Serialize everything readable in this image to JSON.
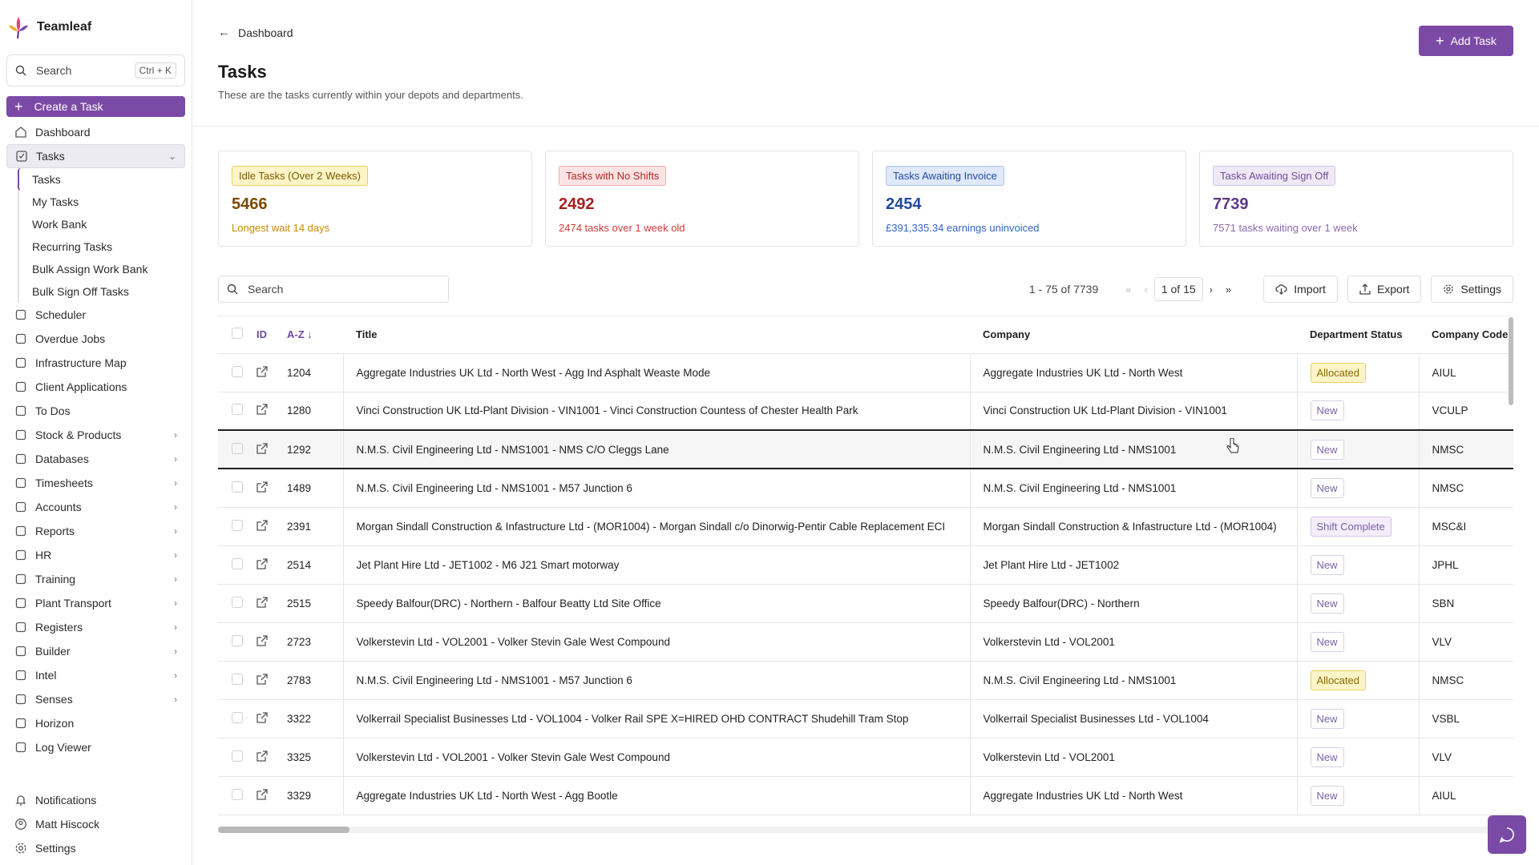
{
  "app": {
    "name": "Teamleaf"
  },
  "sidebar": {
    "search_label": "Search",
    "search_shortcut": "Ctrl + K",
    "create_label": "Create a Task",
    "items": [
      {
        "label": "Dashboard",
        "icon": "home-icon"
      },
      {
        "label": "Tasks",
        "icon": "checkbox-icon"
      },
      {
        "label": "Scheduler",
        "icon": "calendar-icon"
      },
      {
        "label": "Overdue Jobs",
        "icon": "warning-icon"
      },
      {
        "label": "Infrastructure Map",
        "icon": "map-icon"
      },
      {
        "label": "Client Applications",
        "icon": "chat-icon"
      },
      {
        "label": "To Dos",
        "icon": "list-icon"
      },
      {
        "label": "Stock & Products",
        "icon": "cubes-icon"
      },
      {
        "label": "Databases",
        "icon": "database-icon"
      },
      {
        "label": "Timesheets",
        "icon": "clock-icon"
      },
      {
        "label": "Accounts",
        "icon": "pound-icon"
      },
      {
        "label": "Reports",
        "icon": "bar-chart-icon"
      },
      {
        "label": "HR",
        "icon": "users-icon"
      },
      {
        "label": "Training",
        "icon": "graduation-cap-icon"
      },
      {
        "label": "Plant Transport",
        "icon": "truck-icon"
      },
      {
        "label": "Registers",
        "icon": "book-icon"
      },
      {
        "label": "Builder",
        "icon": "layers-icon"
      },
      {
        "label": "Intel",
        "icon": "gear-icon"
      },
      {
        "label": "Senses",
        "icon": "sensor-icon"
      },
      {
        "label": "Horizon",
        "icon": "horizon-icon"
      },
      {
        "label": "Log Viewer",
        "icon": "log-icon"
      }
    ],
    "task_sub": [
      "Tasks",
      "My Tasks",
      "Work Bank",
      "Recurring Tasks",
      "Bulk Assign Work Bank",
      "Bulk Sign Off Tasks"
    ],
    "bottom": {
      "notifications": "Notifications",
      "user": "Matt Hiscock",
      "settings": "Settings"
    }
  },
  "header": {
    "breadcrumb": "Dashboard",
    "title": "Tasks",
    "subtitle": "These are the tasks currently within your depots and departments.",
    "add_button": "Add Task"
  },
  "cards": [
    {
      "badge": "Idle Tasks (Over 2 Weeks)",
      "value": "5466",
      "sub": "Longest wait 14 days"
    },
    {
      "badge": "Tasks with No Shifts",
      "value": "2492",
      "sub": "2474 tasks over 1 week old"
    },
    {
      "badge": "Tasks Awaiting Invoice",
      "value": "2454",
      "sub": "£391,335.34 earnings uninvoiced"
    },
    {
      "badge": "Tasks Awaiting Sign Off",
      "value": "7739",
      "sub": "7571 tasks waiting over 1 week"
    }
  ],
  "toolbar": {
    "search_placeholder": "Search",
    "range": "1 - 75 of 7739",
    "page": "1 of 15",
    "import": "Import",
    "export": "Export",
    "settings": "Settings"
  },
  "table": {
    "headers": {
      "id": "ID",
      "sort": "A-Z",
      "title": "Title",
      "company": "Company",
      "status": "Department Status",
      "code": "Company Code"
    },
    "rows": [
      {
        "id": "1204",
        "title": "Aggregate Industries UK Ltd - North West - Agg Ind Asphalt Weaste Mode",
        "company": "Aggregate Industries UK Ltd - North West",
        "status": "Allocated",
        "code": "AIUL"
      },
      {
        "id": "1280",
        "title": "Vinci Construction UK Ltd-Plant Division - VIN1001 - Vinci Construction Countess of Chester Health Park",
        "company": "Vinci Construction UK Ltd-Plant Division - VIN1001",
        "status": "New",
        "code": "VCULP"
      },
      {
        "id": "1292",
        "title": "N.M.S. Civil Engineering Ltd - NMS1001 - NMS C/O Cleggs Lane",
        "company": "N.M.S. Civil Engineering Ltd - NMS1001",
        "status": "New",
        "code": "NMSC"
      },
      {
        "id": "1489",
        "title": "N.M.S. Civil Engineering Ltd - NMS1001 - M57 Junction 6",
        "company": "N.M.S. Civil Engineering Ltd - NMS1001",
        "status": "New",
        "code": "NMSC"
      },
      {
        "id": "2391",
        "title": "Morgan Sindall Construction & Infastructure Ltd - (MOR1004) - Morgan Sindall c/o Dinorwig-Pentir Cable Replacement ECI",
        "company": "Morgan Sindall Construction & Infastructure Ltd - (MOR1004)",
        "status": "Shift Complete",
        "code": "MSC&I"
      },
      {
        "id": "2514",
        "title": "Jet Plant Hire Ltd - JET1002 - M6 J21 Smart motorway",
        "company": "Jet Plant Hire Ltd - JET1002",
        "status": "New",
        "code": "JPHL"
      },
      {
        "id": "2515",
        "title": "Speedy Balfour(DRC) - Northern - Balfour Beatty Ltd Site Office",
        "company": "Speedy Balfour(DRC) - Northern",
        "status": "New",
        "code": "SBN"
      },
      {
        "id": "2723",
        "title": "Volkerstevin Ltd - VOL2001 - Volker Stevin Gale West Compound",
        "company": "Volkerstevin Ltd - VOL2001",
        "status": "New",
        "code": "VLV"
      },
      {
        "id": "2783",
        "title": "N.M.S. Civil Engineering Ltd - NMS1001 - M57 Junction 6",
        "company": "N.M.S. Civil Engineering Ltd - NMS1001",
        "status": "Allocated",
        "code": "NMSC"
      },
      {
        "id": "3322",
        "title": "Volkerrail Specialist Businesses Ltd - VOL1004 - Volker Rail SPE X=HIRED OHD CONTRACT Shudehill Tram Stop",
        "company": "Volkerrail Specialist Businesses Ltd - VOL1004",
        "status": "New",
        "code": "VSBL"
      },
      {
        "id": "3325",
        "title": "Volkerstevin Ltd - VOL2001 - Volker Stevin Gale West Compound",
        "company": "Volkerstevin Ltd - VOL2001",
        "status": "New",
        "code": "VLV"
      },
      {
        "id": "3329",
        "title": "Aggregate Industries UK Ltd - North West - Agg Bootle",
        "company": "Aggregate Industries UK Ltd - North West",
        "status": "New",
        "code": "AIUL"
      }
    ]
  },
  "colors": {
    "accent": "#7b4aa6"
  }
}
